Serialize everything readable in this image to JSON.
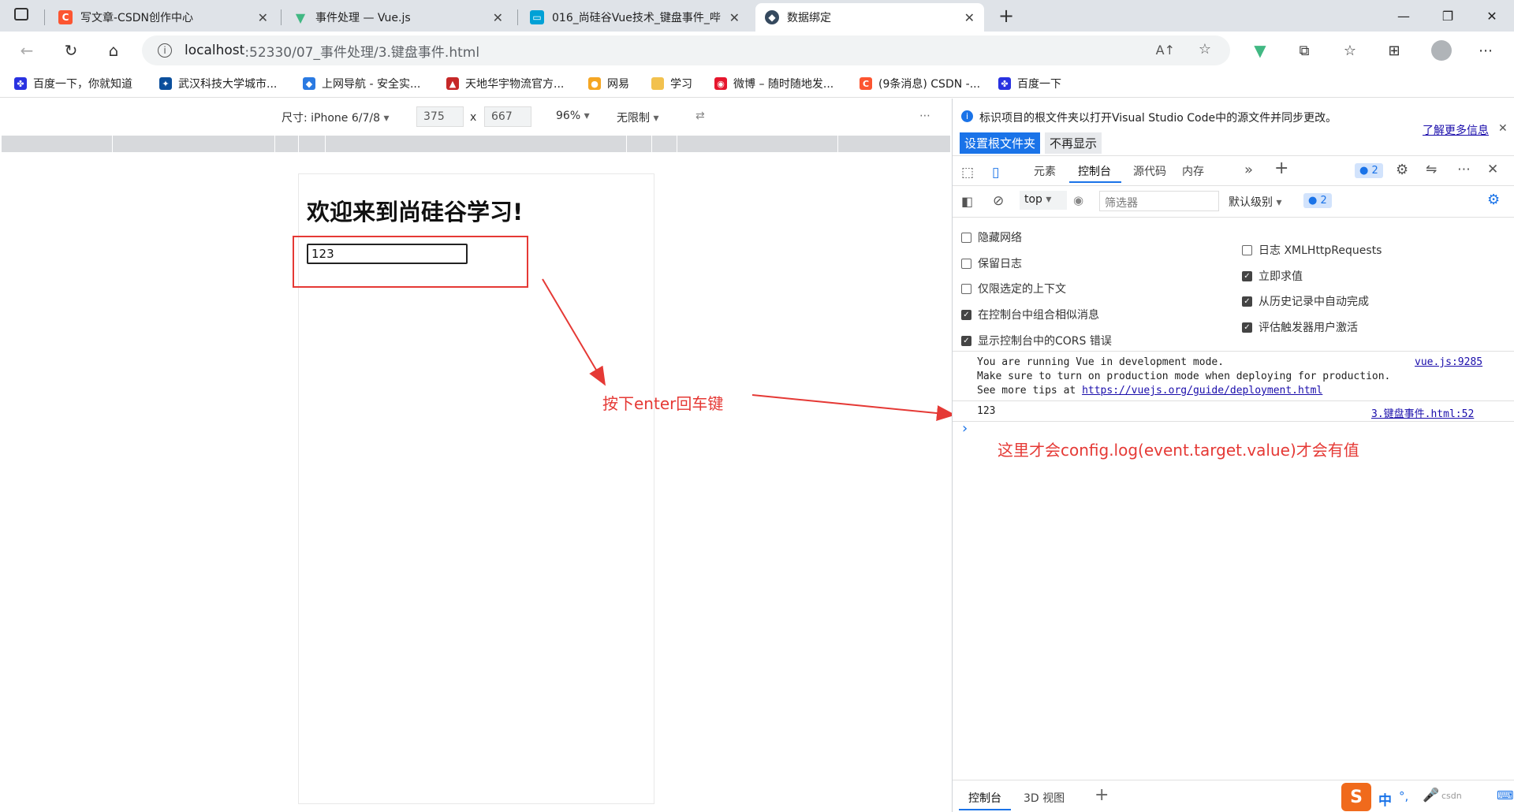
{
  "tabs": [
    {
      "title": "写文章-CSDN创作中心",
      "icon": "csdn-icon",
      "color": "#fc5531"
    },
    {
      "title": "事件处理 — Vue.js",
      "icon": "vue-icon",
      "color": "#41b883"
    },
    {
      "title": "016_尚硅谷Vue技术_键盘事件_哔",
      "icon": "bilibili-icon",
      "color": "#00a1d6"
    },
    {
      "title": "数据绑定",
      "icon": "page-icon",
      "color": "#35495e"
    }
  ],
  "address": {
    "host": "localhost",
    "path": ":52330/07_事件处理/3.键盘事件.html"
  },
  "bookmarks": [
    {
      "label": "百度一下，你就知道",
      "color": "#2932e1"
    },
    {
      "label": "武汉科技大学城市...",
      "color": "#0b4f9c"
    },
    {
      "label": "上网导航 - 安全实...",
      "color": "#2a7ae2"
    },
    {
      "label": "天地华宇物流官方...",
      "color": "#c62828"
    },
    {
      "label": "网易",
      "color": "#f5a623"
    },
    {
      "label": "学习",
      "color": "#f2c14e"
    },
    {
      "label": "微博 – 随时随地发...",
      "color": "#e6162d"
    },
    {
      "label": "(9条消息) CSDN -...",
      "color": "#fc5531"
    },
    {
      "label": "百度一下",
      "color": "#2932e1"
    }
  ],
  "device": {
    "label": "尺寸: iPhone 6/7/8",
    "width": "375",
    "times": "x",
    "height": "667",
    "zoom": "96%",
    "throttle": "无限制"
  },
  "page": {
    "heading": "欢迎来到尚硅谷学习!",
    "input_value": "123"
  },
  "annotations": {
    "press_enter": "按下enter回车键",
    "note": "这里才会config.log(event.target.value)才会有值"
  },
  "devtools": {
    "info": "标识项目的根文件夹以打开Visual Studio Code中的源文件并同步更改。",
    "learn_more": "了解更多信息",
    "set_root": "设置根文件夹",
    "dismiss": "不再显示",
    "tabs": [
      "元素",
      "控制台",
      "源代码",
      "内存"
    ],
    "issue_count": "2",
    "context": "top",
    "filter_placeholder": "筛选器",
    "level": "默认级别",
    "settings": [
      {
        "label": "隐藏网络",
        "checked": false
      },
      {
        "label": "保留日志",
        "checked": false
      },
      {
        "label": "仅限选定的上下文",
        "checked": false
      },
      {
        "label": "在控制台中组合相似消息",
        "checked": true
      },
      {
        "label": "显示控制台中的CORS 错误",
        "checked": true
      },
      {
        "label": "日志 XMLHttpRequests",
        "checked": false
      },
      {
        "label": "立即求值",
        "checked": true
      },
      {
        "label": "从历史记录中自动完成",
        "checked": true
      },
      {
        "label": "评估触发器用户激活",
        "checked": true
      }
    ],
    "console": {
      "line1": "You are running Vue in development mode.",
      "line2": "Make sure to turn on production mode when deploying for production.",
      "line3_prefix": "See more tips at ",
      "line3_link": "https://vuejs.org/guide/deployment.html",
      "source1": "vue.js:9285",
      "log_value": "123",
      "source2": "3.键盘事件.html:52",
      "prompt": "›"
    },
    "drawer_tabs": [
      "控制台",
      "3D 视图"
    ]
  },
  "ime": {
    "lang": "中",
    "punct": "°,",
    "label": "csdn"
  }
}
